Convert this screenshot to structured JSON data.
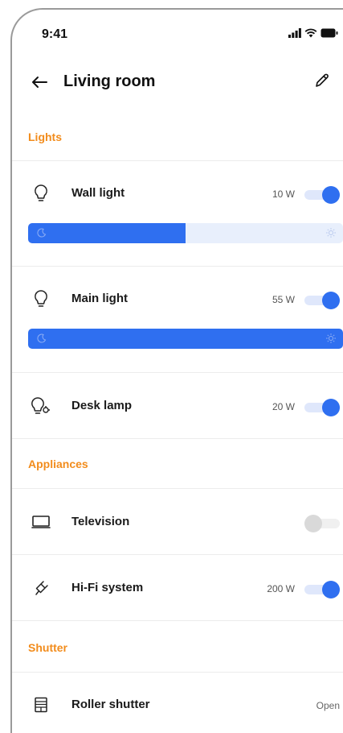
{
  "status_bar": {
    "time": "9:41"
  },
  "header": {
    "title": "Living room"
  },
  "sections": {
    "lights": {
      "title": "Lights"
    },
    "appliances": {
      "title": "Appliances"
    },
    "shutter": {
      "title": "Shutter"
    }
  },
  "devices": {
    "wall_light": {
      "name": "Wall light",
      "power": "10 W",
      "on": true,
      "brightness": 0.5,
      "icon": "lightbulb-icon"
    },
    "main_light": {
      "name": "Main light",
      "power": "55 W",
      "on": true,
      "brightness": 1.0,
      "icon": "lightbulb-icon"
    },
    "desk_lamp": {
      "name": "Desk lamp",
      "power": "20 W",
      "on": true,
      "icon": "desk-lamp-icon"
    },
    "television": {
      "name": "Television",
      "on": false,
      "icon": "television-icon"
    },
    "hifi": {
      "name": "Hi-Fi system",
      "power": "200 W",
      "on": true,
      "icon": "plug-icon"
    },
    "roller_shutter": {
      "name": "Roller shutter",
      "state": "Open",
      "icon": "roller-shutter-icon"
    }
  },
  "colors": {
    "accent": "#2f6ff0",
    "section_header": "#f28c1c"
  }
}
